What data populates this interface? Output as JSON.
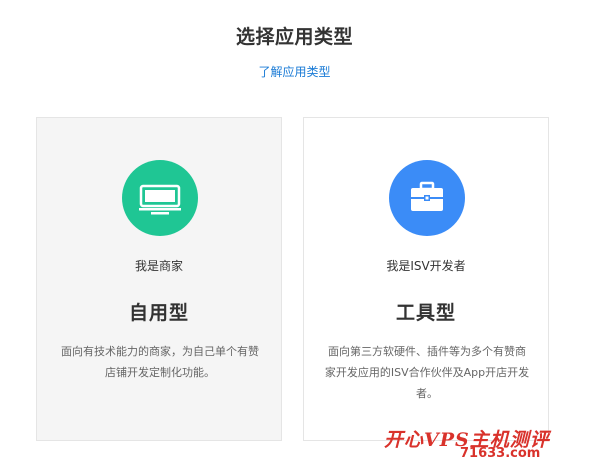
{
  "header": {
    "title": "选择应用类型",
    "learn_link": "了解应用类型"
  },
  "cards": [
    {
      "role": "我是商家",
      "type_name": "自用型",
      "description": "面向有技术能力的商家，为自己单个有赞店铺开发定制化功能。",
      "icon": "monitor-icon",
      "icon_color": "#1fc694",
      "background": "#f5f5f5"
    },
    {
      "role": "我是ISV开发者",
      "type_name": "工具型",
      "description": "面向第三方软硬件、插件等为多个有赞商家开发应用的ISV合作伙伴及App开店开发者。",
      "icon": "briefcase-icon",
      "icon_color": "#3b8cf7",
      "background": "#ffffff"
    }
  ],
  "watermark": {
    "text": "开心VPS主机测评",
    "url": "71633.com"
  },
  "colors": {
    "link": "#1a7bd6",
    "watermark": "#d9322b"
  }
}
